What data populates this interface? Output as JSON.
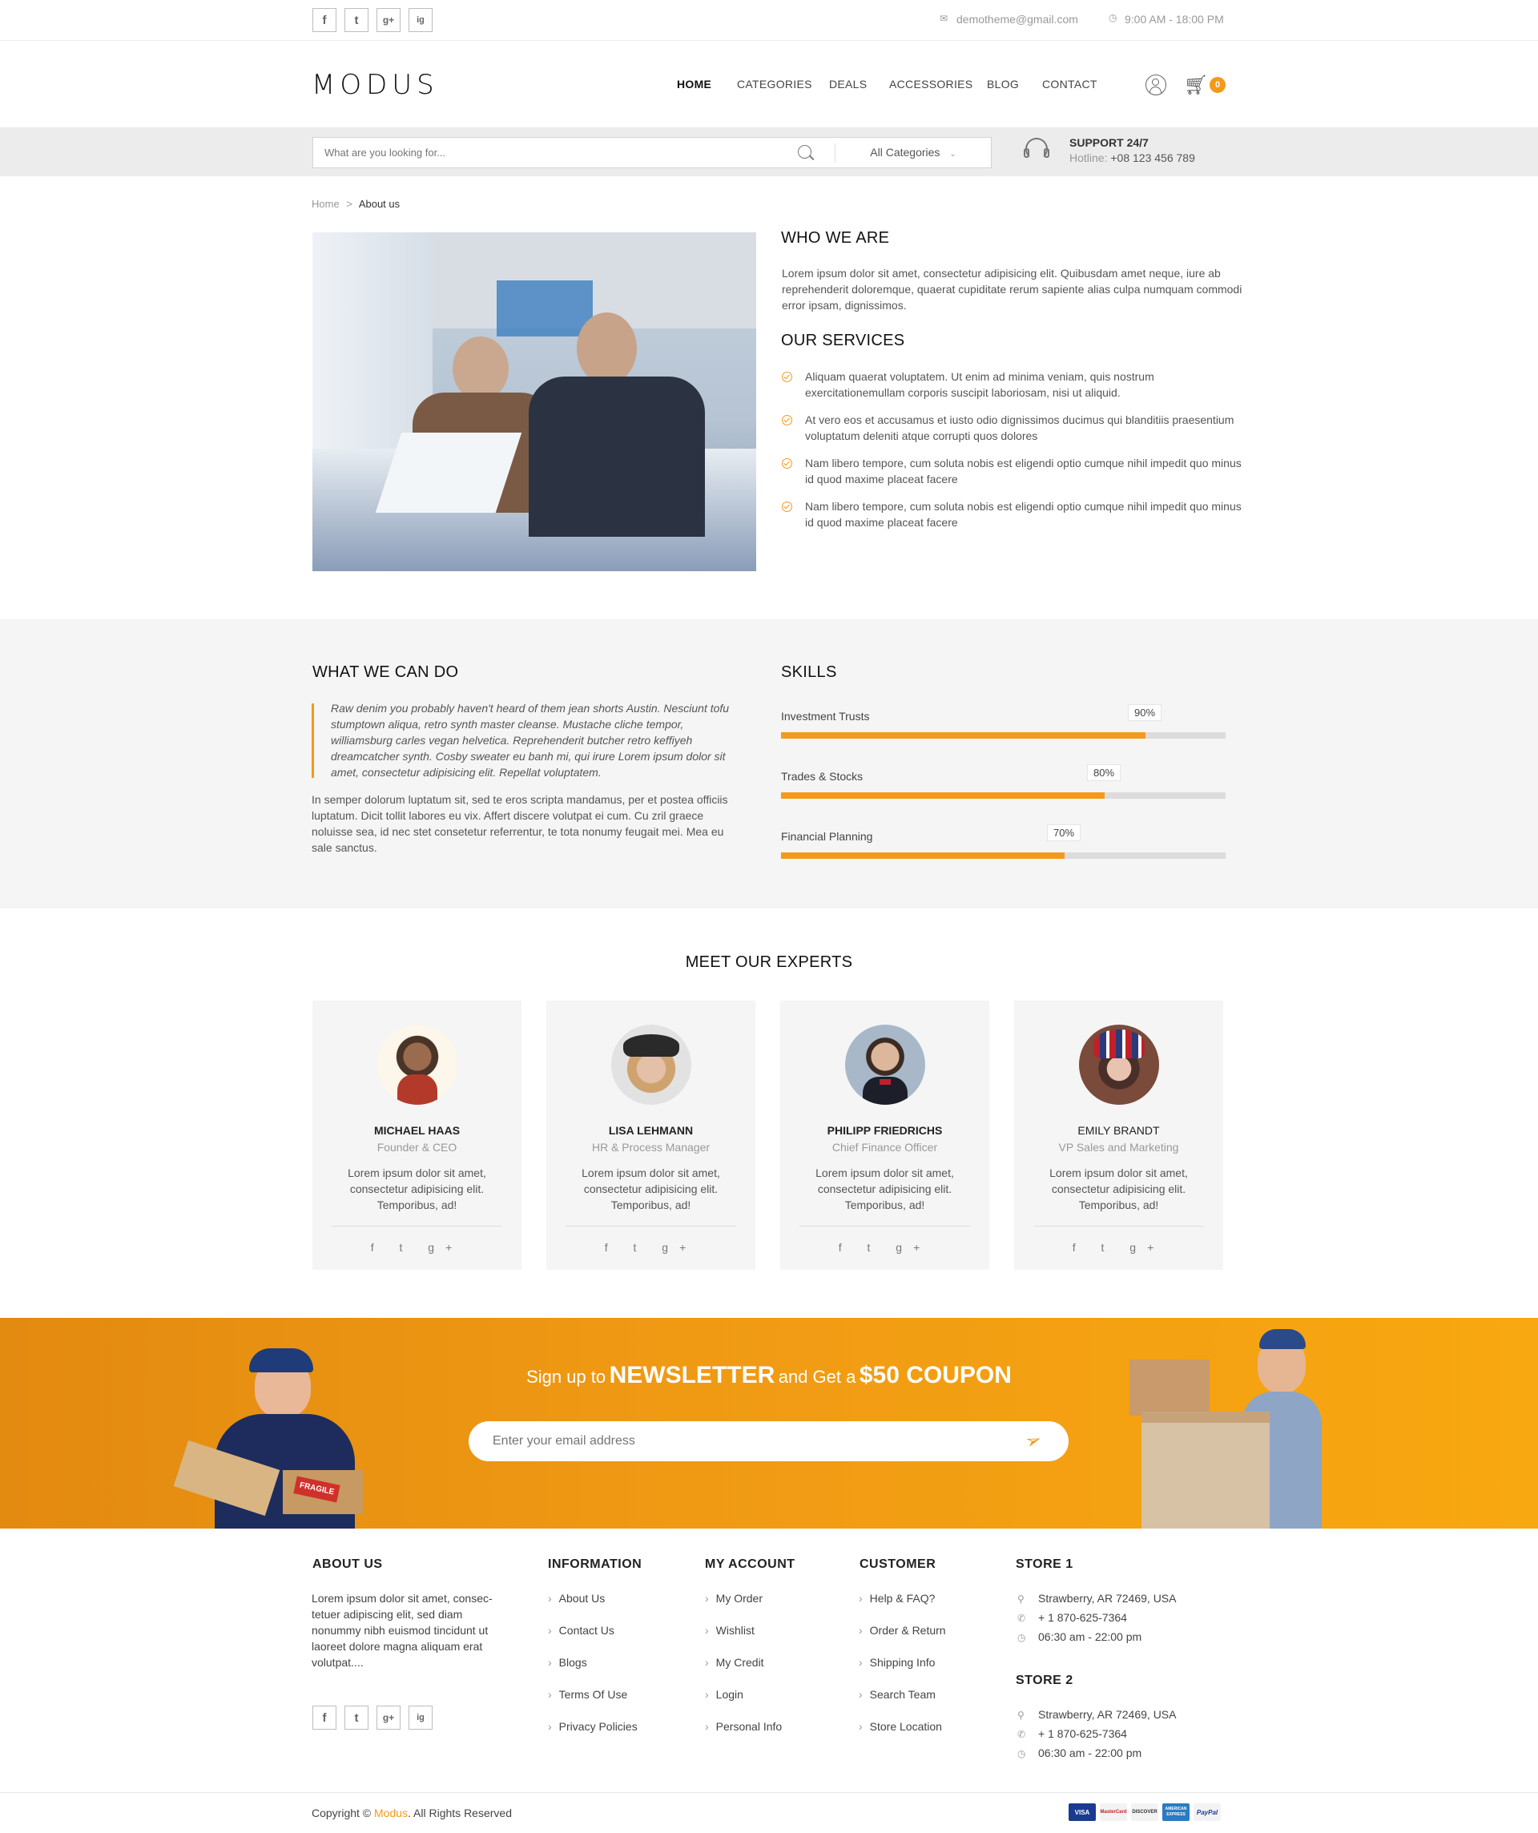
{
  "topbar": {
    "social": [
      "f",
      "t",
      "g+",
      "ig"
    ],
    "email": "demotheme@gmail.com",
    "hours": "9:00 AM - 18:00 PM"
  },
  "header": {
    "logo": "MODUS",
    "nav": [
      "HOME",
      "CATEGORIES",
      "DEALS",
      "ACCESSORIES",
      "BLOG",
      "CONTACT"
    ],
    "cart_count": "0"
  },
  "search": {
    "placeholder": "What are you looking for...",
    "category": "All Categories",
    "support_title": "SUPPORT 24/7",
    "hotline_label": "Hotline:",
    "hotline": "+08 123 456 789"
  },
  "breadcrumb": {
    "home": "Home",
    "sep": ">",
    "current": "About us"
  },
  "who": {
    "title": "WHO WE ARE",
    "text": "Lorem ipsum dolor sit amet, consectetur adipisicing elit. Quibusdam amet neque, iure ab reprehenderit doloremque, quaerat cupiditate rerum sapiente alias culpa numquam commodi error ipsam, dignissimos."
  },
  "services": {
    "title": "OUR SERVICES",
    "items": [
      "Aliquam quaerat voluptatem. Ut enim ad minima veniam, quis nostrum exercitationemullam corporis suscipit laboriosam, nisi ut aliquid.",
      "At vero eos et accusamus et iusto odio dignissimos ducimus qui blanditiis praesentium voluptatum deleniti atque corrupti quos dolores",
      "Nam libero tempore, cum soluta nobis est eligendi optio cumque nihil impedit quo minus id quod maxime placeat facere",
      "Nam libero tempore, cum soluta nobis est eligendi optio cumque nihil impedit quo minus id quod maxime placeat facere"
    ]
  },
  "whatwedo": {
    "title": "WHAT WE CAN DO",
    "quote": "Raw denim you probably haven't heard of them jean shorts Austin. Nesciunt tofu stumptown aliqua, retro synth master cleanse. Mustache cliche tempor, williamsburg carles vegan helvetica. Reprehenderit butcher retro keffiyeh dreamcatcher synth. Cosby sweater eu banh mi, qui irure Lorem ipsum dolor sit amet, consectetur adipisicing elit. Repellat voluptatem.",
    "text": "In semper dolorum luptatum sit, sed te eros scripta mandamus, per et postea officiis luptatum. Dicit tollit labores eu vix. Affert discere volutpat ei cum. Cu zril graece noluisse sea, id nec stet consetetur referrentur, te tota nonumy feugait mei. Mea eu sale sanctus."
  },
  "skills": {
    "title": "SKILLS",
    "items": [
      {
        "label": "Investment Trusts",
        "percent": 90,
        "text": "90%"
      },
      {
        "label": "Trades & Stocks",
        "percent": 80,
        "text": "80%"
      },
      {
        "label": "Financial Planning",
        "percent": 70,
        "text": "70%"
      }
    ]
  },
  "experts": {
    "title": "MEET OUR EXPERTS",
    "people": [
      {
        "name": "MICHAEL HAAS",
        "role": "Founder & CEO",
        "desc": "Lorem ipsum dolor sit amet, consectetur adipisicing elit. Temporibus, ad!"
      },
      {
        "name": "LISA LEHMANN",
        "role": "HR & Process Manager",
        "desc": "Lorem ipsum dolor sit amet, consectetur adipisicing elit. Temporibus, ad!"
      },
      {
        "name": "PHILIPP FRIEDRICHS",
        "role": "Chief Finance Officer",
        "desc": "Lorem ipsum dolor sit amet, consectetur adipisicing elit. Temporibus, ad!"
      },
      {
        "name": "EMILY BRANDT",
        "role": "VP Sales and Marketing",
        "desc": "Lorem ipsum dolor sit amet, consectetur adipisicing elit. Temporibus, ad!"
      }
    ],
    "social": "f t g+"
  },
  "newsletter": {
    "pre": "Sign up to",
    "strong1": "NEWSLETTER",
    "mid": "and Get a",
    "strong2": "$50 COUPON",
    "placeholder": "Enter your email address",
    "box_label": "FRAGILE"
  },
  "footer": {
    "about_title": "ABOUT US",
    "about_text": "Lorem ipsum dolor sit amet, consec- tetuer adipiscing elit, sed diam nonummy nibh euismod tincidunt ut laoreet dolore magna aliquam erat volutpat....",
    "info_title": "INFORMATION",
    "info": [
      "About Us",
      "Contact Us",
      "Blogs",
      "Terms Of Use",
      "Privacy Policies"
    ],
    "account_title": "MY ACCOUNT",
    "account": [
      "My Order",
      "Wishlist",
      "My Credit",
      "Login",
      "Personal Info"
    ],
    "customer_title": "CUSTOMER",
    "customer": [
      "Help & FAQ?",
      "Order & Return",
      "Shipping Info",
      "Search Team",
      "Store Location"
    ],
    "store1_title": "STORE 1",
    "store2_title": "STORE 2",
    "store_address": "Strawberry, AR 72469, USA",
    "store_phone": "+ 1 870-625-7364",
    "store_hours": "06:30 am - 22:00 pm",
    "copyright_pre": "Copyright ©",
    "copyright_brand": "Modus",
    "copyright_post": ". All Rights Reserved",
    "payments": [
      "VISA",
      "MasterCard",
      "DISCOVER",
      "AMERICAN EXPRESS",
      "PayPal"
    ]
  },
  "colors": {
    "accent": "#f39a1c",
    "grey_band": "#f5f5f5"
  }
}
